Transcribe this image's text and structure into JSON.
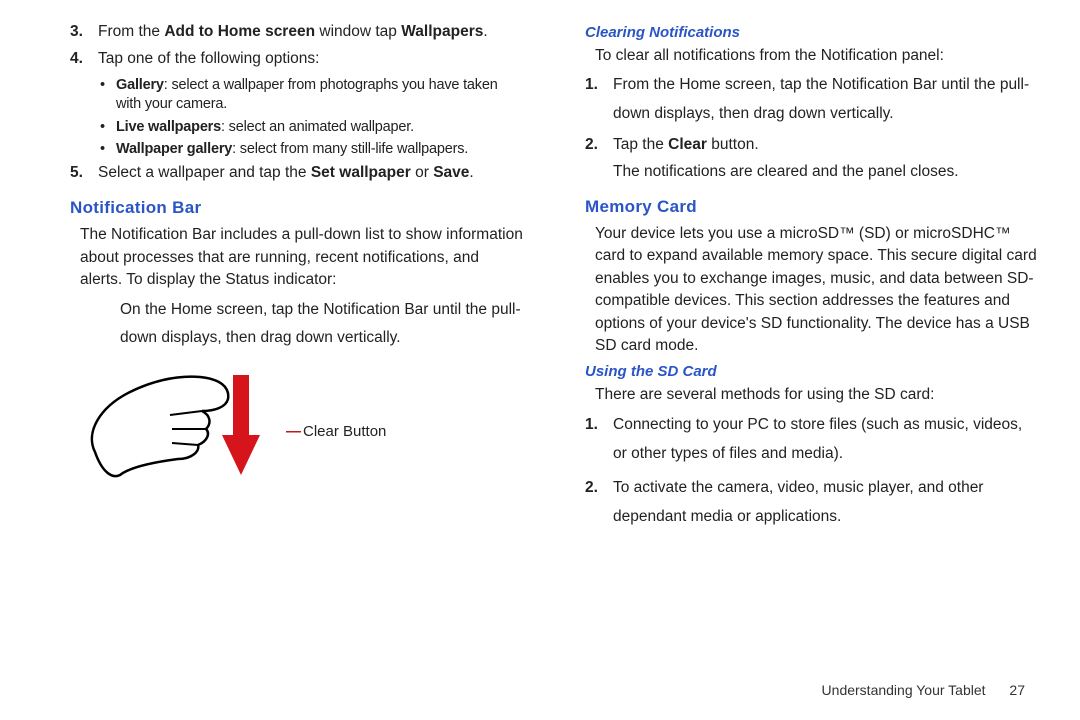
{
  "left": {
    "step3_pre": "From the ",
    "step3_b1": "Add to Home screen",
    "step3_mid": " window tap ",
    "step3_b2": "Wallpapers",
    "step4": "Tap one of the following options:",
    "bullet1_b": "Gallery",
    "bullet1_t": ": select a wallpaper from photographs you have taken with your camera.",
    "bullet2_b": "Live wallpapers",
    "bullet2_t": ": select an animated wallpaper.",
    "bullet3_b": "Wallpaper gallery",
    "bullet3_t": ": select from many still-life wallpapers.",
    "step5_pre": "Select a wallpaper and tap the ",
    "step5_b1": "Set wallpaper",
    "step5_mid": " or ",
    "step5_b2": "Save",
    "h1": "Notification Bar",
    "p1": "The Notification Bar includes a pull-down list to show information about processes that are running, recent notifications, and alerts. To display the Status indicator:",
    "p2": "On the Home screen, tap the Notification Bar until the pull-down displays, then drag down vertically.",
    "caption": "Clear Button"
  },
  "right": {
    "h_clear": "Clearing Notifications",
    "p_clear": "To clear all notifications from the Notification panel:",
    "s1": "From the Home screen, tap the Notification Bar until the pull-down displays, then drag down vertically.",
    "s2_pre": "Tap the ",
    "s2_b": "Clear",
    "s2_post": " button.",
    "s2_out": "The notifications are cleared and the panel closes.",
    "h_mem": "Memory Card",
    "p_mem": "Your device lets you use a microSD™ (SD) or microSDHC™ card to expand available memory space. This secure digital card enables you to exchange images, music, and data between SD-compatible devices. This section addresses the features and options of your device's SD functionality. The device has a USB SD card mode.",
    "h_sd": "Using the SD Card",
    "p_sd": "There are several methods for using the SD card:",
    "sd1": "Connecting to your PC to store files (such as music, videos, or other types of files and media).",
    "sd2": "To activate the camera, video, music player, and other dependant media or applications."
  },
  "footer": {
    "section": "Understanding Your Tablet",
    "page": "27"
  },
  "nums": {
    "n1": "1.",
    "n2": "2.",
    "n3": "3.",
    "n4": "4.",
    "n5": "5.",
    "dot": "•"
  }
}
